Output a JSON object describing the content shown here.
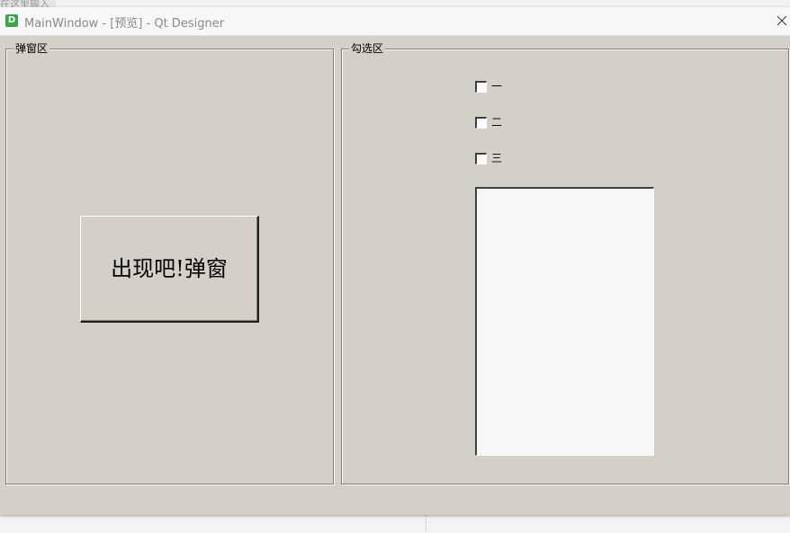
{
  "window": {
    "title": "MainWindow - [预览] - Qt Designer",
    "app_icon_letter": "D"
  },
  "background": {
    "partial_text": "在这里输入"
  },
  "group_popup": {
    "title": "弹窗区",
    "button_label": "出现吧!弹窗"
  },
  "group_check": {
    "title": "勾选区",
    "checkboxes": [
      {
        "label": "一",
        "checked": false
      },
      {
        "label": "二",
        "checked": false
      },
      {
        "label": "三",
        "checked": false
      }
    ],
    "text_area_value": ""
  },
  "colors": {
    "window_bg": "#d4d0c8",
    "titlebar_bg": "#f7f7f7",
    "app_icon": "#3aa64a"
  },
  "icons": {
    "close": "close-icon",
    "app": "qt-designer-icon"
  }
}
